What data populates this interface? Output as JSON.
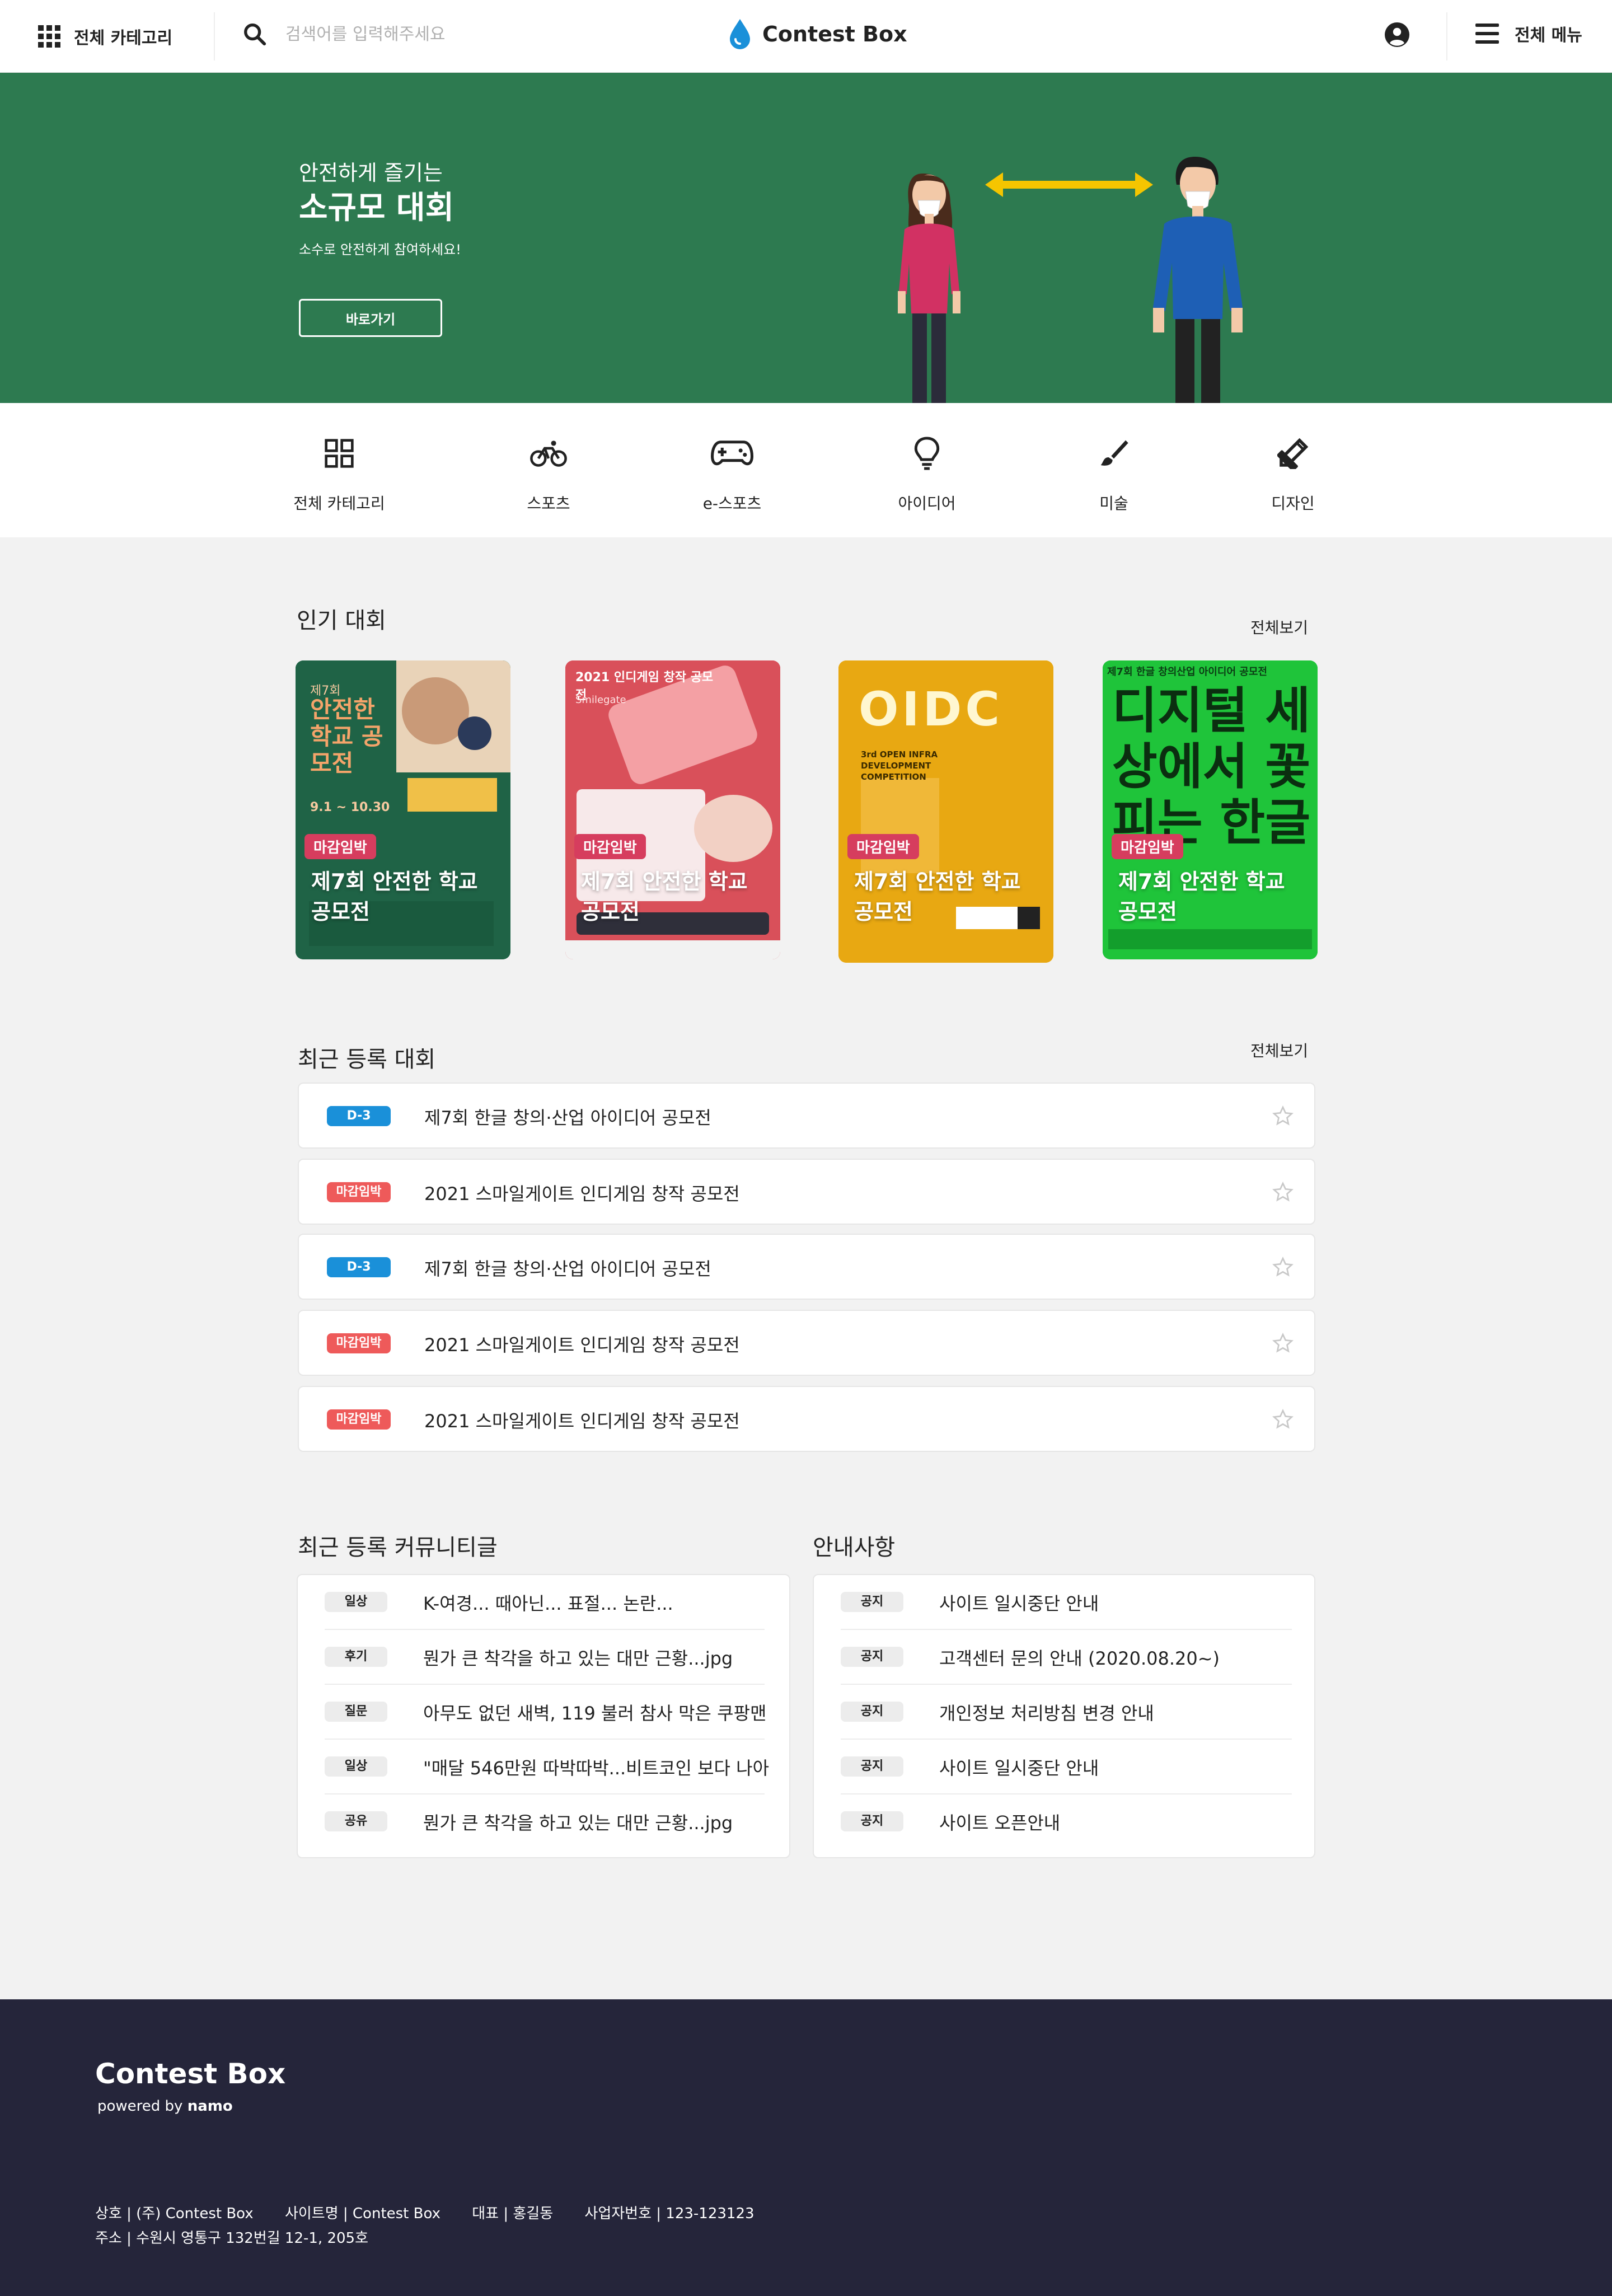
{
  "header": {
    "category_label": "전체 카테고리",
    "search_placeholder": "검색어를 입력해주세요",
    "logo_text": "Contest Box",
    "menu_label": "전체 메뉴"
  },
  "hero": {
    "subtitle": "안전하게 즐기는",
    "title": "소규모 대회",
    "description": "소수로 안전하게 참여하세요!",
    "button_label": "바로가기"
  },
  "categories": [
    {
      "label": "전체 카테고리",
      "icon": "grid-icon"
    },
    {
      "label": "스포츠",
      "icon": "bicycle-icon"
    },
    {
      "label": "e-스포츠",
      "icon": "gamepad-icon"
    },
    {
      "label": "아이디어",
      "icon": "lightbulb-icon"
    },
    {
      "label": "미술",
      "icon": "brush-icon"
    },
    {
      "label": "디자인",
      "icon": "design-tools-icon"
    }
  ],
  "popular": {
    "title": "인기 대회",
    "see_all": "전체보기",
    "cards": [
      {
        "badge": "마감임박",
        "title": "제7회 안전한 학교 공모전",
        "poster_heading": "안전한 학교 공모전",
        "poster_top": "제7회",
        "poster_date": "9.1 ~ 10.30"
      },
      {
        "badge": "마감임박",
        "title": "제7회 안전한 학교 공모전",
        "poster_heading": "2021 인디게임 창작 공모전",
        "poster_top": "Smilegate",
        "poster_date": ""
      },
      {
        "badge": "마감임박",
        "title": "제7회 안전한 학교 공모전",
        "poster_heading": "OIDC",
        "poster_top": "3rd OPEN INFRA DEVELOPMENT COMPETITION",
        "poster_date": ""
      },
      {
        "badge": "마감임박",
        "title": "제7회 안전한 학교 공모전",
        "poster_heading": "디지털 세상에서 꽃피는 한글",
        "poster_top": "제7회 한글 창의산업 아이디어 공모전",
        "poster_date": ""
      }
    ]
  },
  "recent": {
    "title": "최근 등록 대회",
    "see_all": "전체보기",
    "items": [
      {
        "badge": "D-3",
        "badge_color": "#1a90d9",
        "text": "제7회 한글 창의·산업 아이디어 공모전"
      },
      {
        "badge": "마감임박",
        "badge_color": "#ee5a5a",
        "text": "2021 스마일게이트 인디게임 창작 공모전"
      },
      {
        "badge": "D-3",
        "badge_color": "#1a90d9",
        "text": "제7회 한글 창의·산업 아이디어 공모전"
      },
      {
        "badge": "마감임박",
        "badge_color": "#ee5a5a",
        "text": "2021 스마일게이트 인디게임 창작 공모전"
      },
      {
        "badge": "마감임박",
        "badge_color": "#ee5a5a",
        "text": "2021 스마일게이트 인디게임 창작 공모전"
      }
    ]
  },
  "community": {
    "title": "최근 등록 커뮤니티글",
    "items": [
      {
        "tag": "일상",
        "text": "K-여경... 때아닌... 표절... 논란..."
      },
      {
        "tag": "후기",
        "text": "뭔가 큰 착각을 하고 있는 대만 근황...jpg"
      },
      {
        "tag": "질문",
        "text": "아무도 없던 새벽, 119 불러 참사 막은 쿠팡맨"
      },
      {
        "tag": "일상",
        "text": "\"매달 546만원 따박따박...비트코인 보다 나아"
      },
      {
        "tag": "공유",
        "text": "뭔가 큰 착각을 하고 있는 대만 근황...jpg"
      }
    ]
  },
  "notice": {
    "title": "안내사항",
    "items": [
      {
        "tag": "공지",
        "text": "사이트 일시중단 안내"
      },
      {
        "tag": "공지",
        "text": "고객센터 문의 안내 (2020.08.20~)"
      },
      {
        "tag": "공지",
        "text": "개인정보 처리방침 변경 안내"
      },
      {
        "tag": "공지",
        "text": "사이트 일시중단 안내"
      },
      {
        "tag": "공지",
        "text": "사이트 오픈안내"
      }
    ]
  },
  "footer": {
    "logo": "Contest Box",
    "powered": "powered  by",
    "powered_brand": "namo",
    "line1": [
      "상호 | (주) Contest Box",
      "사이트명 | Contest Box",
      "대표 | 홍길동",
      "사업자번호 | 123-123123"
    ],
    "line2": "주소 | 수원시 영통구 132번길 12-1, 205호"
  },
  "colors": {
    "hero_bg": "#2d7a50",
    "badge_red": "#d63d5e",
    "dday_blue": "#1a90d9",
    "urgent_red": "#ee5a5a",
    "footer_bg": "#25253a",
    "logo_drop": "#1a90d9"
  }
}
